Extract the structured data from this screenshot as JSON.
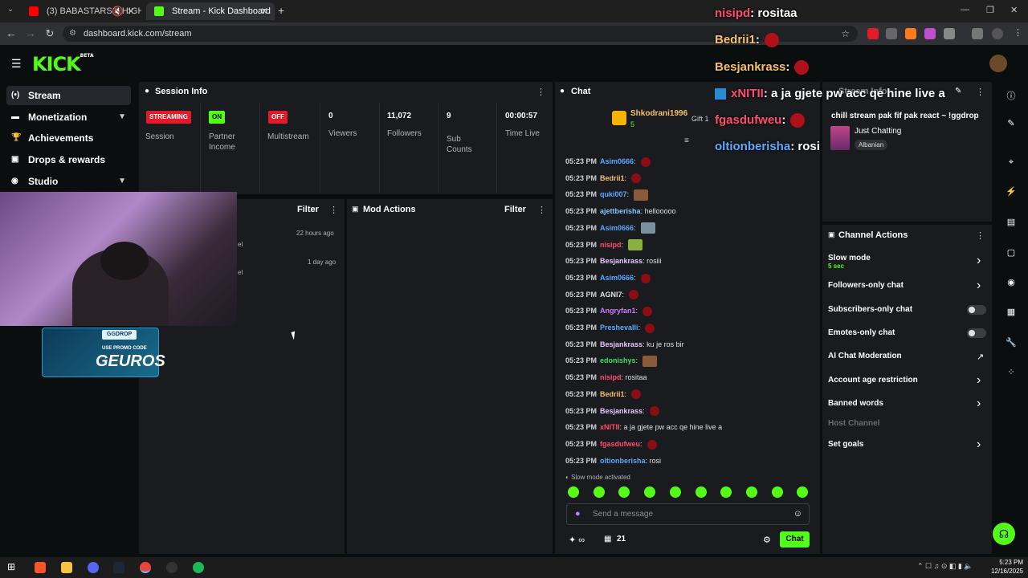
{
  "browser": {
    "tabs": [
      {
        "title": "(3) BABASTARS – HIGH 10",
        "color": "#ff0000"
      },
      {
        "title": "Stream - Kick Dashboard",
        "color": "#53fc18"
      }
    ],
    "new_tab": "+",
    "url": "dashboard.kick.com/stream"
  },
  "site": {
    "logo": "KICK",
    "logo_tag": "BETA"
  },
  "sidebar": {
    "items": [
      {
        "label": "Stream",
        "icon": "broadcast-icon"
      },
      {
        "label": "Monetization",
        "icon": "money-icon"
      },
      {
        "label": "Achievements",
        "icon": "trophy-icon"
      },
      {
        "label": "Drops & rewards",
        "icon": "gift-icon"
      },
      {
        "label": "Studio",
        "icon": "studio-icon"
      }
    ]
  },
  "session": {
    "title": "Session Info",
    "streaming": "STREAMING",
    "session_label": "Session",
    "partner_badge": "ON",
    "partner_label": "Partner Income",
    "multistream_badge": "OFF",
    "multistream_label": "Multistream",
    "viewers": "0",
    "viewers_label": "Viewers",
    "followers": "11,072",
    "followers_label": "Followers",
    "subs": "9",
    "subs_label": "Sub Counts",
    "time_live": "00:00:57",
    "time_label": "Time Live"
  },
  "activity": {
    "filter": "Filter",
    "entries": [
      {
        "time": "22 hours ago",
        "text": "el"
      },
      {
        "time": "1 day ago",
        "text": "el"
      }
    ]
  },
  "mod_actions": {
    "title": "Mod Actions",
    "filter": "Filter"
  },
  "promo": {
    "brand": "GGDROP",
    "line": "USE PROMO CODE",
    "code": "GEUROS"
  },
  "chat": {
    "title": "Chat",
    "pinned_user": "Shkodrani1996",
    "pinned_count": "5",
    "gift_label": "Gift 1",
    "messages": [
      {
        "time": "05:23 PM",
        "user": "Asim0666",
        "color": "#5fa8ff",
        "text": ":",
        "emote": "red"
      },
      {
        "time": "05:23 PM",
        "user": "Bedrii1",
        "color": "#f5c16c",
        "text": ":",
        "emote": "red"
      },
      {
        "time": "05:23 PM",
        "user": "quki007",
        "color": "#5fa8ff",
        "text": ":",
        "emote": "face"
      },
      {
        "time": "05:23 PM",
        "user": "ajettberisha",
        "color": "#7ec8ff",
        "text": ": hellooooo",
        "emote": ""
      },
      {
        "time": "05:23 PM",
        "user": "Asim0666",
        "color": "#5fa8ff",
        "text": ":",
        "emote": "grey"
      },
      {
        "time": "05:23 PM",
        "user": "nisipd",
        "color": "#ff4d6d",
        "text": ":",
        "emote": "green"
      },
      {
        "time": "05:23 PM",
        "user": "Besjankrass",
        "color": "#e8c8ff",
        "text": ": rosiii",
        "emote": ""
      },
      {
        "time": "05:23 PM",
        "user": "Asim0666",
        "color": "#5fa8ff",
        "text": ":",
        "emote": "red"
      },
      {
        "time": "05:23 PM",
        "user": "AGNI7",
        "color": "#e0e0e0",
        "text": ":",
        "emote": "red"
      },
      {
        "time": "05:23 PM",
        "user": "Angryfan1",
        "color": "#c77dff",
        "text": ":",
        "emote": "red"
      },
      {
        "time": "05:23 PM",
        "user": "Preshevalli",
        "color": "#5fa8ff",
        "text": ":",
        "emote": "red"
      },
      {
        "time": "05:23 PM",
        "user": "Besjankrass",
        "color": "#e8c8ff",
        "text": ": ku je ros bir",
        "emote": ""
      },
      {
        "time": "05:23 PM",
        "user": "edonishys",
        "color": "#4cd964",
        "text": ":",
        "emote": "face"
      },
      {
        "time": "05:23 PM",
        "user": "nisipd",
        "color": "#ff4d6d",
        "text": ": rositaa",
        "emote": ""
      },
      {
        "time": "05:23 PM",
        "user": "Bedrii1",
        "color": "#f5c16c",
        "text": ":",
        "emote": "red"
      },
      {
        "time": "05:23 PM",
        "user": "Besjankrass",
        "color": "#e8c8ff",
        "text": ":",
        "emote": "red"
      },
      {
        "time": "05:23 PM",
        "user": "xNITII",
        "color": "#ff4d6d",
        "text": ": a ja gjete pw acc qe hine live a",
        "emote": ""
      },
      {
        "time": "05:23 PM",
        "user": "fgasdufweu",
        "color": "#ff4d6d",
        "text": ":",
        "emote": "red"
      },
      {
        "time": "05:23 PM",
        "user": "oltionberisha",
        "color": "#5fa8ff",
        "text": ": rosi",
        "emote": ""
      }
    ],
    "slow_notice": "Slow mode activated",
    "input_placeholder": "Send a message",
    "viewer_count": "21",
    "send_button": "Chat"
  },
  "overlay": [
    {
      "user": "nisipd",
      "text": ": rositaa",
      "color": "#ff4d6d"
    },
    {
      "user": "Bedrii1",
      "text": ":",
      "color": "#f5c16c"
    },
    {
      "user": "Besjankrass",
      "text": ":",
      "color": "#f5c16c"
    },
    {
      "user": "xNITII",
      "text": ": a ja gjete pw acc qe hine live a",
      "color": "#ff4d6d"
    },
    {
      "user": "fgasdufweu",
      "text": ":",
      "color": "#ff4d6d"
    },
    {
      "user": "oltionberisha",
      "text": ": rosi",
      "color": "#5fa8ff"
    }
  ],
  "stream_info": {
    "title": "Stream Info",
    "stream_title": "chill stream pak fif pak react ~ !ggdrop🔥",
    "category": "Just Chatting",
    "tag": "Albanian"
  },
  "channel_actions": {
    "title": "Channel Actions",
    "items": [
      {
        "label": "Slow mode",
        "sub": "5 sec",
        "control": "arrow"
      },
      {
        "label": "Followers-only chat",
        "sub": "",
        "control": "arrow"
      },
      {
        "label": "Subscribers-only chat",
        "sub": "",
        "control": "toggle"
      },
      {
        "label": "Emotes-only chat",
        "sub": "",
        "control": "toggle"
      },
      {
        "label": "AI Chat Moderation",
        "sub": "",
        "control": "external"
      },
      {
        "label": "Account age restriction",
        "sub": "",
        "control": "arrow"
      },
      {
        "label": "Banned words",
        "sub": "",
        "control": "arrow"
      },
      {
        "label": "Host Channel",
        "sub": "",
        "control": "none"
      },
      {
        "label": "Set goals",
        "sub": "",
        "control": "arrow"
      }
    ]
  },
  "taskbar": {
    "time": "5:23 PM",
    "date": "12/16/2025"
  },
  "colors": {
    "accent": "#53fc18",
    "streaming_red": "#e21b2a",
    "panel_bg": "#191b1f"
  }
}
